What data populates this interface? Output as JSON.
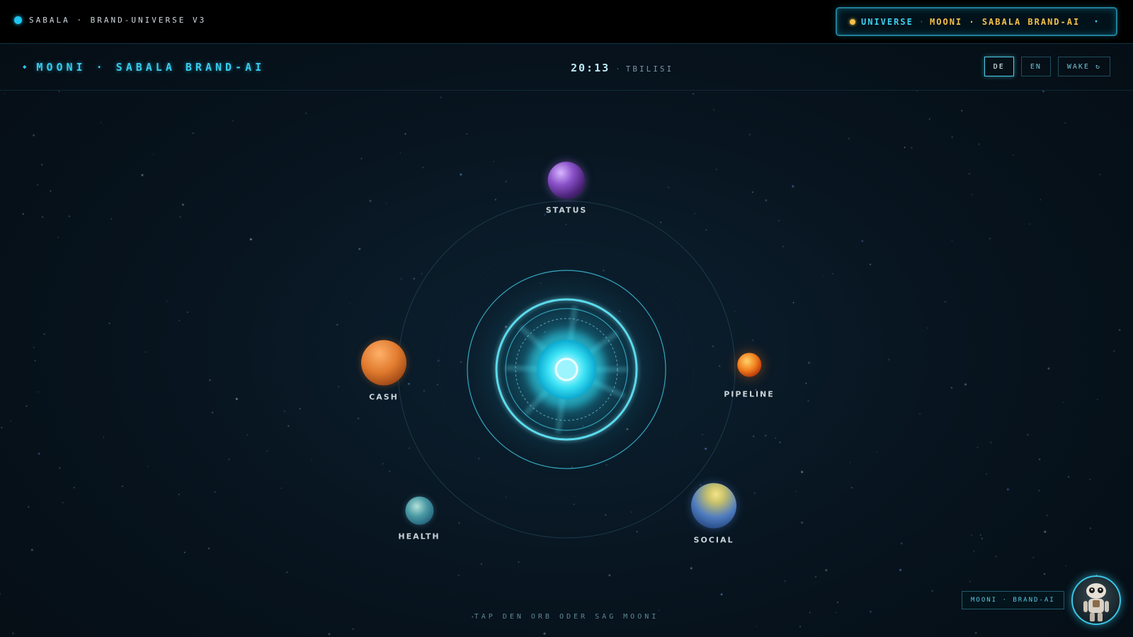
{
  "system_bar": {
    "brand": "SABALA · BRAND-UNIVERSE V3",
    "selector": {
      "part_a": "UNIVERSE",
      "separator": "·",
      "part_b": "MOONI · SABALA BRAND-AI",
      "chevron": "▾"
    }
  },
  "header": {
    "title": "MOONI · SABALA BRAND-AI",
    "clock": {
      "time": "20:13",
      "separator": "·",
      "city": "TBILISI"
    },
    "buttons": {
      "de": "DE",
      "en": "EN",
      "wake": "WAKE ↻"
    },
    "active_language": "DE"
  },
  "planets": {
    "status": {
      "label": "STATUS"
    },
    "cash": {
      "label": "CASH"
    },
    "pipeline": {
      "label": "PIPELINE"
    },
    "health": {
      "label": "HEALTH"
    },
    "social": {
      "label": "SOCIAL"
    }
  },
  "footer": {
    "hint": "TAP DEN ORB ODER SAG MOONI",
    "badge": "MOONI · BRAND-AI"
  },
  "colors": {
    "accent": "#35cdef",
    "amber": "#f3c04a",
    "background": "#07131d"
  },
  "icons": {
    "live": "live-dot-icon",
    "selector_status": "amber-dot-icon",
    "selector_open": "chevron-down-icon",
    "wake": "refresh-icon",
    "avatar": "robot-avatar-icon"
  }
}
